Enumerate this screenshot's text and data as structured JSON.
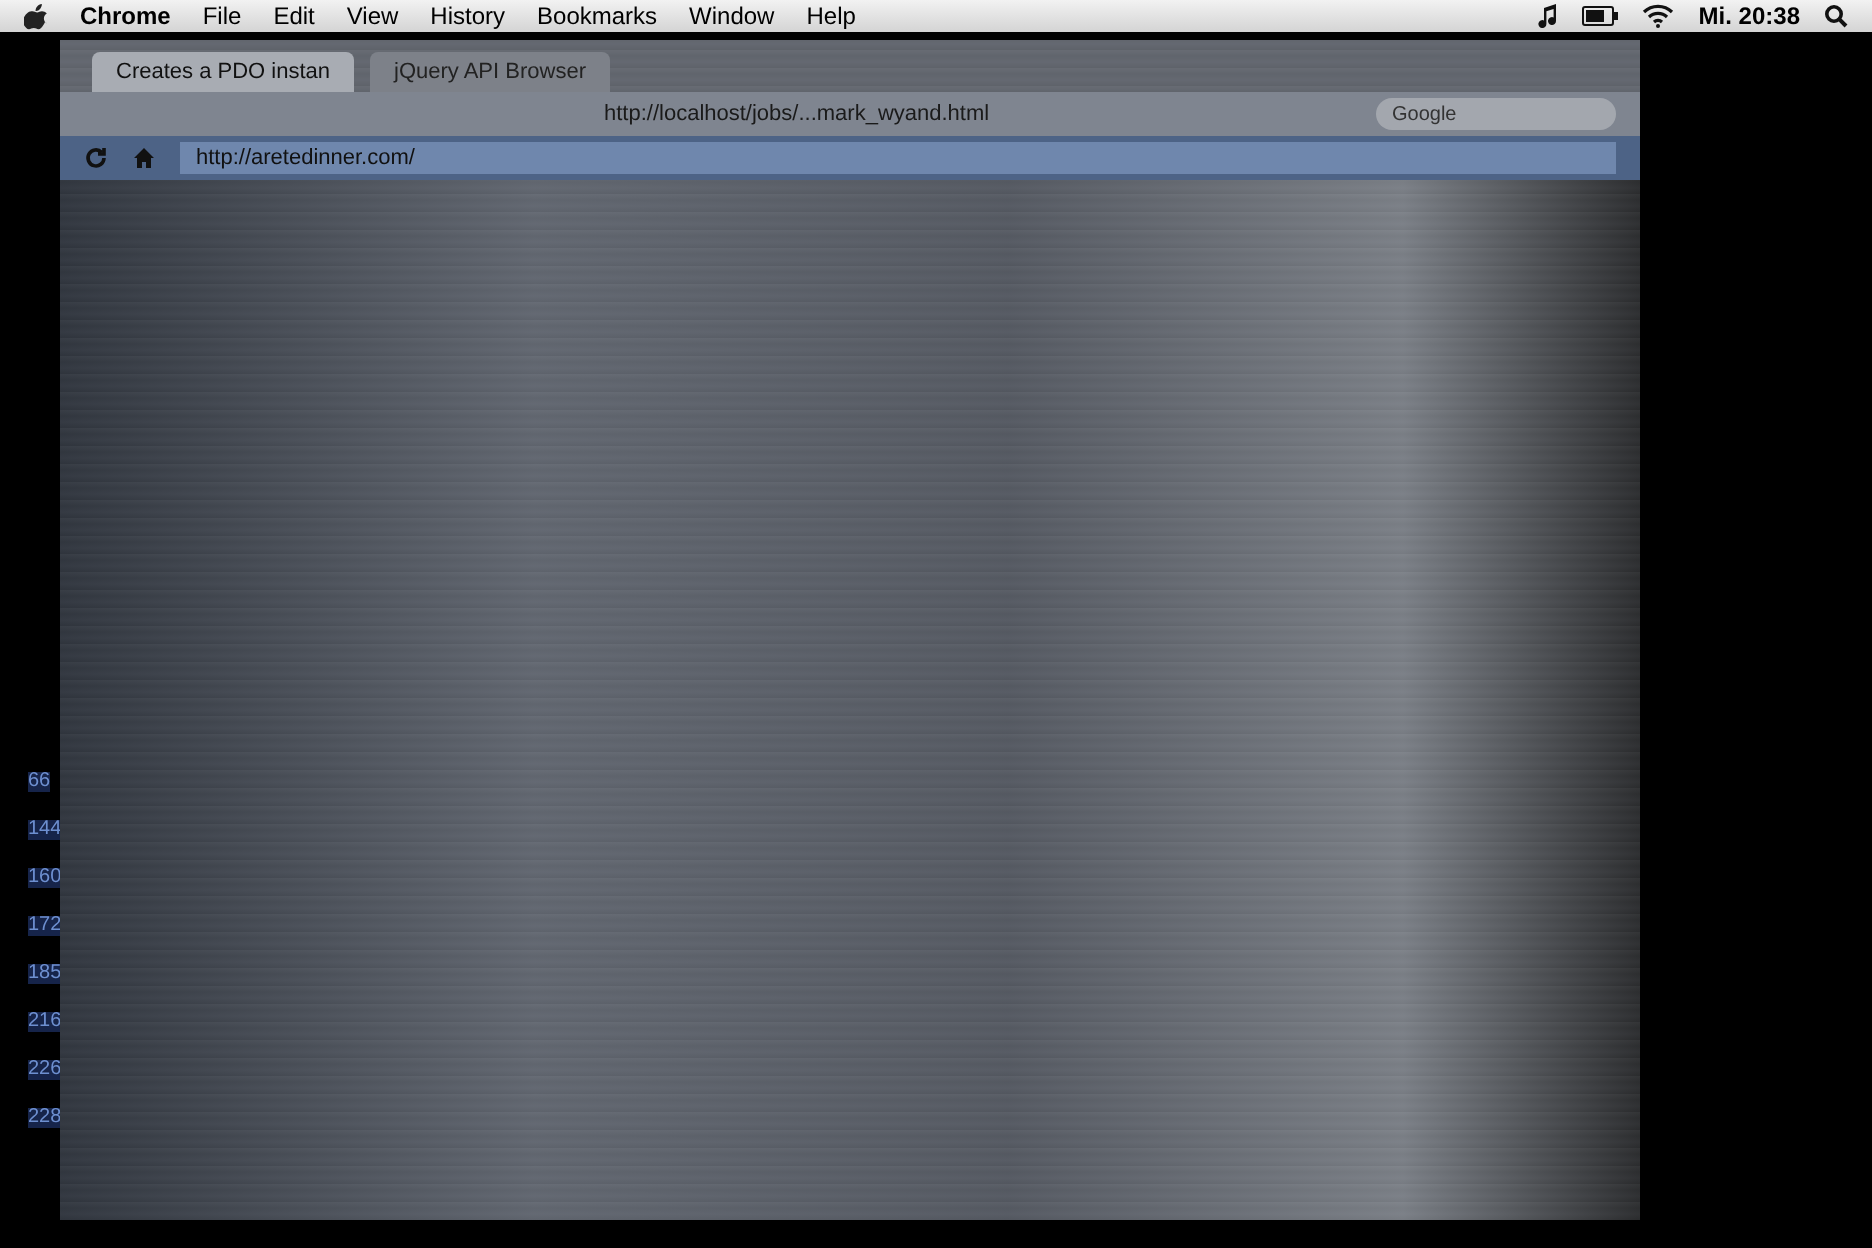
{
  "menu_bar": {
    "menus": [
      "Chrome",
      "File",
      "Edit",
      "View",
      "History",
      "Bookmarks",
      "Window",
      "Help"
    ],
    "clock": "Mi. 20:38"
  },
  "browser": {
    "tabs": [
      {
        "label": "Creates a PDO instan",
        "selected": true
      },
      {
        "label": "jQuery API Browser",
        "selected": false
      }
    ],
    "url": "http://aretedinner.com/",
    "second_url": "http://localhost/jobs/...mark_wyand.html",
    "search_placeholder": "Google"
  },
  "editor": {
    "line_numbers": [
      "66",
      "144",
      "160",
      "172",
      "185",
      "216",
      "226",
      "228"
    ]
  }
}
